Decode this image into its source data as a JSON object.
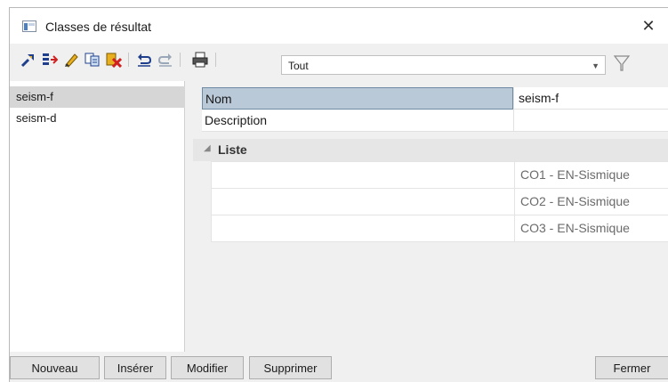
{
  "window": {
    "title": "Classes de résultat",
    "close_glyph": "✕"
  },
  "toolbar": {
    "icons": [
      "pin-icon",
      "insert-rows-icon",
      "edit-pencil-icon",
      "copy-icon",
      "delete-icon",
      "undo-icon",
      "redo-icon",
      "print-icon",
      "filter-icon"
    ],
    "filter": {
      "value": "Tout"
    }
  },
  "list": {
    "items": [
      {
        "label": "seism-f",
        "selected": true
      },
      {
        "label": "seism-d",
        "selected": false
      }
    ]
  },
  "properties": {
    "name_label": "Nom",
    "name_value": "seism-f",
    "description_label": "Description",
    "description_value": "",
    "group_label": "Liste",
    "list_values": [
      "CO1 - EN-Sismique",
      "CO2 - EN-Sismique",
      "CO3 - EN-Sismique"
    ]
  },
  "buttons": {
    "new": "Nouveau",
    "insert": "Insérer",
    "modify": "Modifier",
    "delete": "Supprimer",
    "close": "Fermer"
  },
  "colors": {
    "selection_bg": "#b9c9d8",
    "list_selected_bg": "#d6d6d6",
    "window_bg": "#f0f0f0"
  }
}
